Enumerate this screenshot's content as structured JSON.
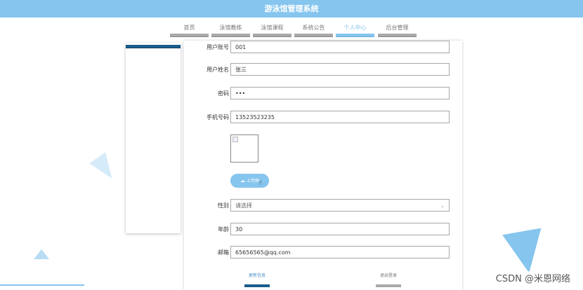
{
  "app_title": "游泳馆管理系统",
  "nav": [
    {
      "label": "首页",
      "active": false
    },
    {
      "label": "泳馆教练",
      "active": false
    },
    {
      "label": "泳馆课程",
      "active": false
    },
    {
      "label": "系统公告",
      "active": false
    },
    {
      "label": "个人中心",
      "active": true
    },
    {
      "label": "后台管理",
      "active": false
    }
  ],
  "form": {
    "account": {
      "label": "用户账号",
      "value": "001"
    },
    "name": {
      "label": "用户姓名",
      "value": "张三"
    },
    "password": {
      "label": "密码",
      "value": "•••"
    },
    "phone": {
      "label": "手机号码",
      "value": "13523523235"
    },
    "upload_label": "上传图",
    "gender": {
      "label": "性别",
      "value": "请选择"
    },
    "age": {
      "label": "年龄",
      "value": "30"
    },
    "email": {
      "label": "邮箱",
      "value": "65656565@qq.com"
    }
  },
  "actions": {
    "update_label": "更新信息",
    "logout_label": "退出登录"
  },
  "watermark": "CSDN @米恩网络",
  "colors": {
    "accent": "#85c5ee",
    "dark_accent": "#1a5c8c"
  }
}
